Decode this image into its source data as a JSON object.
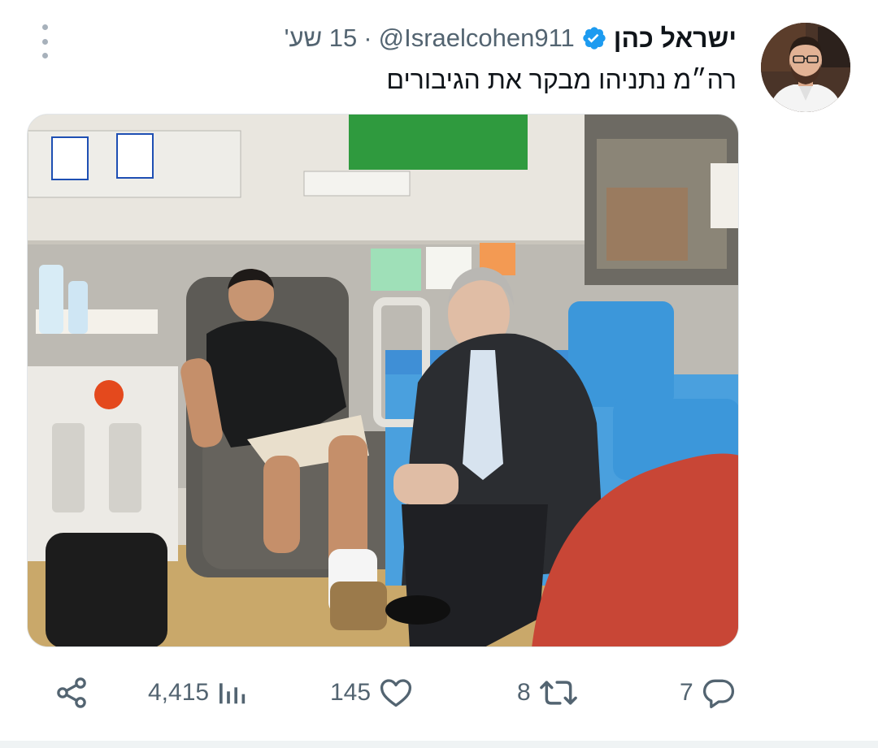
{
  "tweet": {
    "author": {
      "display_name": "ישראל כהן",
      "handle": "@Israelcohen911",
      "verified": true,
      "avatar_icon": "user-avatar"
    },
    "separator": "·",
    "time": "15 שע'",
    "text": "רה״מ נתניהו מבקר את הגיבורים",
    "media": {
      "type": "photo",
      "icon": "photo-hospital-room"
    },
    "metrics": {
      "views": "4,415",
      "likes": "145",
      "retweets": "8",
      "replies": "7"
    },
    "icons": {
      "more": "more-vertical-icon",
      "share": "share-icon",
      "views": "views-icon",
      "like": "heart-icon",
      "retweet": "retweet-icon",
      "reply": "reply-icon"
    }
  },
  "colors": {
    "text": "#0f1419",
    "secondary": "#536471",
    "verified": "#1d9bf0",
    "divider": "#eff3f4"
  }
}
